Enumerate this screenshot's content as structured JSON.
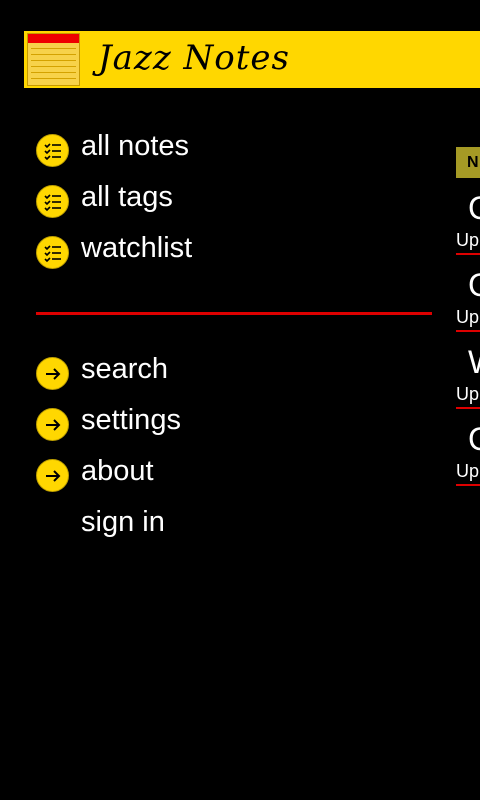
{
  "header": {
    "title": "Jazz Notes",
    "logo_icon": "jazz-notes-logo-icon",
    "logo_text": "JAZZ NOTES",
    "color": "#ffd700"
  },
  "menu": {
    "primary": [
      {
        "label": "all notes",
        "icon": "list-icon"
      },
      {
        "label": "all tags",
        "icon": "list-icon"
      },
      {
        "label": "watchlist",
        "icon": "list-icon"
      }
    ],
    "secondary": [
      {
        "label": "search",
        "icon": "arrow-right-icon"
      },
      {
        "label": "settings",
        "icon": "arrow-right-icon"
      },
      {
        "label": "about",
        "icon": "arrow-right-icon"
      },
      {
        "label": "sign in",
        "icon": ""
      }
    ]
  },
  "divider_color": "#dd0000",
  "right_panel": {
    "badge": "N",
    "items": [
      {
        "title": "C",
        "subtitle": "Up"
      },
      {
        "title": "C",
        "subtitle": "Up"
      },
      {
        "title": "W",
        "subtitle": "Up"
      },
      {
        "title": "C",
        "subtitle": "Up"
      }
    ]
  }
}
